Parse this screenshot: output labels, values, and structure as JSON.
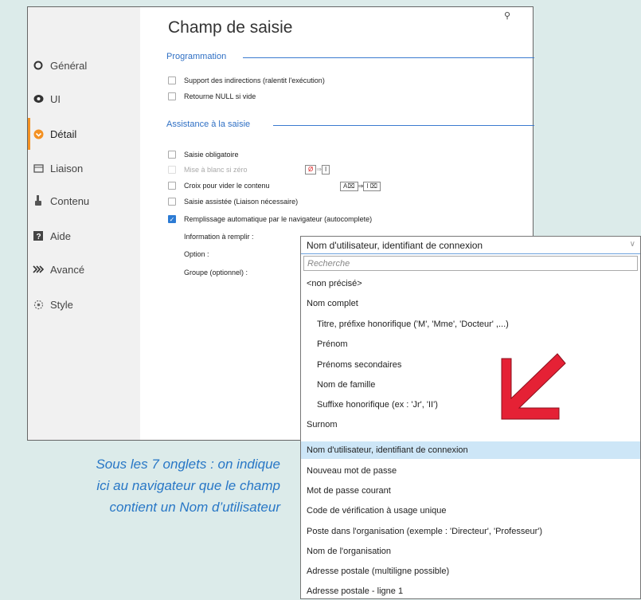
{
  "window": {
    "title": "Champ de saisie",
    "search_icon": "search-icon"
  },
  "sidebar": {
    "items": [
      {
        "label": "Général",
        "icon": "circle-icon"
      },
      {
        "label": "UI",
        "icon": "eye-icon"
      },
      {
        "label": "Détail",
        "icon": "chevron-circle-icon"
      },
      {
        "label": "Liaison",
        "icon": "link-icon"
      },
      {
        "label": "Contenu",
        "icon": "thumb-icon"
      },
      {
        "label": "Aide",
        "icon": "help-icon"
      },
      {
        "label": "Avancé",
        "icon": "double-chevron-icon"
      },
      {
        "label": "Style",
        "icon": "style-icon"
      }
    ],
    "active_color": "#f39123"
  },
  "sections": {
    "programmation": {
      "title": "Programmation",
      "options": [
        "Support des indirections (ralentit l'exécution)",
        "Retourne NULL si vide"
      ]
    },
    "assistance": {
      "title": "Assistance à la saisie",
      "options": [
        "Saisie obligatoire",
        "Mise à blanc si zéro",
        "Croix pour vider le contenu",
        "Saisie assistée (Liaison nécessaire)",
        "Remplissage automatique par le navigateur (autocomplete)"
      ],
      "fields": [
        "Information à remplir :",
        "Option :",
        "Groupe (optionnel) :"
      ]
    },
    "mini": {
      "zero": "Ø",
      "arrow": "⇒",
      "i": "I",
      "ax": "A⌧",
      "ix": "I ⌧"
    }
  },
  "caption": {
    "line1": "Sous les 7 onglets : on indique",
    "line2": "ici au navigateur que le champ",
    "line3": "contient un Nom d’utilisateur"
  },
  "dropdown": {
    "selected": "Nom d'utilisateur, identifiant de connexion",
    "search_placeholder": "Recherche",
    "items": [
      "<non précisé>",
      "Nom complet",
      "Titre, préfixe honorifique ('M', 'Mme', 'Docteur' ,...)",
      "Prénom",
      "Prénoms secondaires",
      "Nom de famille",
      "Suffixe honorifique (ex : 'Jr', 'II')",
      "Surnom",
      "Nom d'utilisateur, identifiant de connexion",
      "Nouveau mot de passe",
      "Mot de passe courant",
      "Code de vérification à usage unique",
      "Poste dans l'organisation (exemple : 'Directeur', 'Professeur')",
      "Nom de l'organisation",
      "Adresse postale (multiligne possible)",
      "Adresse postale - ligne 1"
    ],
    "highlight_color": "#cde6f7"
  },
  "annotation": {
    "arrow_color": "#e52135"
  }
}
